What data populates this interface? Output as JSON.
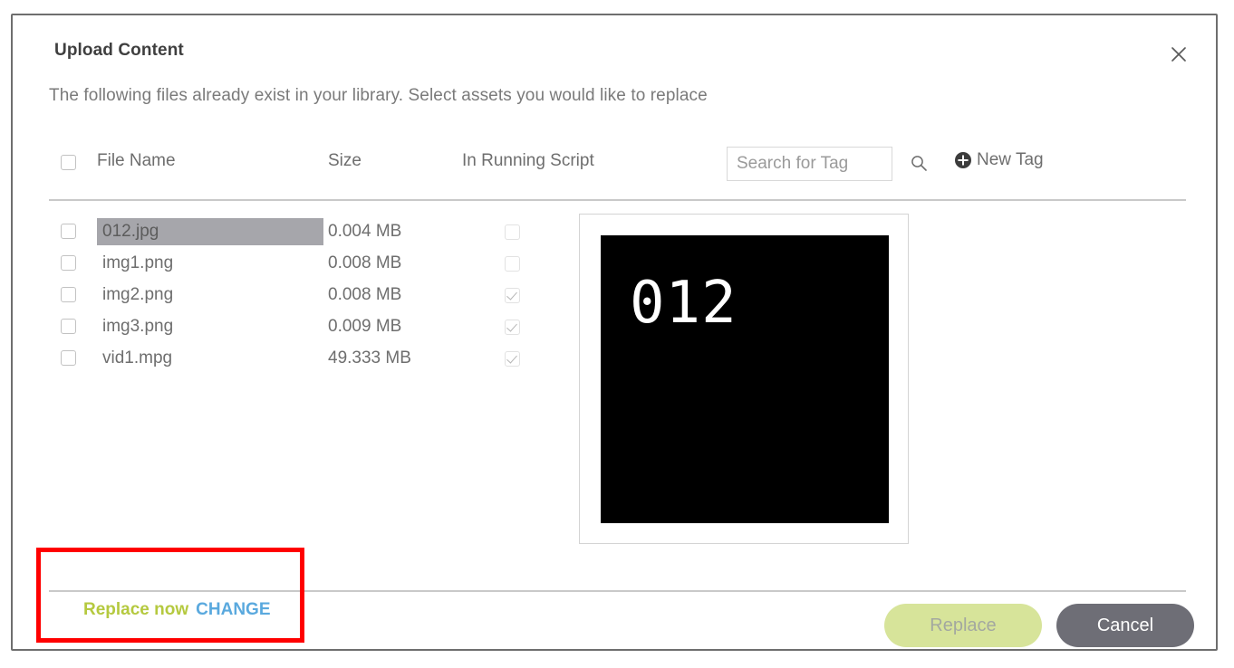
{
  "dialog": {
    "title": "Upload Content",
    "subtitle": "The following files already exist in your library. Select assets you would like to replace",
    "close_icon": "close-icon"
  },
  "table": {
    "select_all_checked": false,
    "columns": {
      "file_name": "File Name",
      "size": "Size",
      "in_running_script": "In Running Script"
    },
    "tag_search": {
      "value": "",
      "placeholder": "Search for Tag",
      "icon": "search-icon"
    },
    "new_tag": {
      "label": "New Tag",
      "icon": "plus-circle-icon"
    },
    "rows": [
      {
        "name": "012.jpg",
        "size": "0.004 MB",
        "selected": true,
        "checked": false,
        "in_script": false
      },
      {
        "name": "img1.png",
        "size": "0.008 MB",
        "selected": false,
        "checked": false,
        "in_script": false
      },
      {
        "name": "img2.png",
        "size": "0.008 MB",
        "selected": false,
        "checked": false,
        "in_script": true
      },
      {
        "name": "img3.png",
        "size": "0.009 MB",
        "selected": false,
        "checked": false,
        "in_script": true
      },
      {
        "name": "vid1.mpg",
        "size": "49.333 MB",
        "selected": false,
        "checked": false,
        "in_script": true
      }
    ]
  },
  "preview": {
    "caption": "012",
    "background": "#000000"
  },
  "footer": {
    "replace_now_label": "Replace now",
    "change_label": "CHANGE",
    "replace_button": "Replace",
    "cancel_button": "Cancel"
  },
  "colors": {
    "replace_now": "#b5c93f",
    "change_link": "#5aa9de",
    "replace_button_bg": "#d7e49a",
    "cancel_button_bg": "#6e6e76",
    "annotation": "#ff0000",
    "row_selected_bg": "#a6a6ab"
  }
}
